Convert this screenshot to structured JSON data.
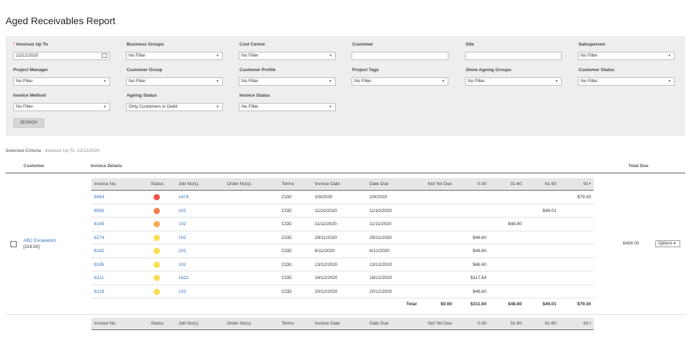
{
  "page": {
    "title": "Aged Receivables Report"
  },
  "filters": {
    "invoices_up_to": {
      "label": "Invoices Up To",
      "required_mark": "*",
      "value": "22/12/2020"
    },
    "business_groups": {
      "label": "Business Groups",
      "value": "No Filter"
    },
    "cost_centre": {
      "label": "Cost Centre",
      "value": "No Filter"
    },
    "customer": {
      "label": "Customer",
      "value": ""
    },
    "site": {
      "label": "Site",
      "value": ""
    },
    "salesperson": {
      "label": "Salesperson",
      "value": "No Filter"
    },
    "project_manager": {
      "label": "Project Manager",
      "value": "No Filter"
    },
    "customer_group": {
      "label": "Customer Group",
      "value": "No Filter"
    },
    "customer_profile": {
      "label": "Customer Profile",
      "value": "No Filter"
    },
    "project_tags": {
      "label": "Project Tags",
      "value": "No Filter"
    },
    "show_ageing_groups": {
      "label": "Show Ageing Groups",
      "value": "No Filter"
    },
    "customer_status": {
      "label": "Customer Status",
      "value": "No Filter"
    },
    "invoice_method": {
      "label": "Invoice Method",
      "value": "No Filter"
    },
    "ageing_status": {
      "label": "Ageing Status",
      "value": "Only Customers in Debit"
    },
    "invoice_status": {
      "label": "Invoice Status",
      "value": "No Filter"
    },
    "search_button": "SEARCH"
  },
  "selected_criteria": {
    "label": "Selected Criteria",
    "text": " - Invoices Up To: 22/12/2020"
  },
  "table": {
    "headers": {
      "customer": "Customer",
      "invoice_details": "Invoice Details",
      "total_due": "Total Due"
    },
    "inner_headers": [
      "Invoice No.",
      "Status",
      "Job No(s).",
      "Order No(s).",
      "Terms",
      "Invoice Date",
      "Date Due",
      "Not Yet Due",
      "0-30",
      "31-60",
      "61-90",
      "91+"
    ],
    "customer": {
      "name": "ABC Excavators",
      "code": "[119.50]",
      "total_due": "$489.05",
      "options_label": "Options ▾"
    },
    "status_colors": {
      "red": "#ef5350",
      "orange": "#f57c4a",
      "amber": "#f9a54f",
      "yellow": "#f7dc4e"
    },
    "rows": [
      {
        "invoice": "8063",
        "status": "red",
        "job": "1474",
        "terms": "COD",
        "invoice_date": "2/9/2020",
        "date_due": "2/9/2020",
        "not_yet_due": "",
        "d0_30": "",
        "d31_60": "",
        "d61_90": "",
        "d91": "$79.30"
      },
      {
        "invoice": "8093",
        "status": "orange",
        "job": "102",
        "terms": "COD",
        "invoice_date": "11/10/2020",
        "date_due": "11/10/2020",
        "not_yet_due": "",
        "d0_30": "",
        "d31_60": "",
        "d61_90": "$49.01",
        "d91": ""
      },
      {
        "invoice": "8149",
        "status": "amber",
        "job": "102",
        "terms": "COD",
        "invoice_date": "11/11/2020",
        "date_due": "11/11/2020",
        "not_yet_due": "",
        "d0_30": "",
        "d31_60": "$48.80",
        "d61_90": "",
        "d91": ""
      },
      {
        "invoice": "8174",
        "status": "yellow",
        "job": "102",
        "terms": "COD",
        "invoice_date": "29/11/2020",
        "date_due": "29/11/2020",
        "not_yet_due": "",
        "d0_30": "$48.60",
        "d31_60": "",
        "d61_90": "",
        "d91": ""
      },
      {
        "invoice": "8182",
        "status": "yellow",
        "job": "102",
        "terms": "COD",
        "invoice_date": "6/12/2020",
        "date_due": "6/12/2020",
        "not_yet_due": "",
        "d0_30": "$48.60",
        "d31_60": "",
        "d61_90": "",
        "d91": ""
      },
      {
        "invoice": "8195",
        "status": "yellow",
        "job": "102",
        "terms": "COD",
        "invoice_date": "13/12/2020",
        "date_due": "13/12/2020",
        "not_yet_due": "",
        "d0_30": "$48.60",
        "d31_60": "",
        "d61_90": "",
        "d91": ""
      },
      {
        "invoice": "8211",
        "status": "yellow",
        "job": "1622",
        "terms": "COD",
        "invoice_date": "16/12/2020",
        "date_due": "16/12/2020",
        "not_yet_due": "",
        "d0_30": "$117.54",
        "d31_60": "",
        "d61_90": "",
        "d91": ""
      },
      {
        "invoice": "8218",
        "status": "yellow",
        "job": "102",
        "terms": "COD",
        "invoice_date": "20/12/2020",
        "date_due": "20/12/2020",
        "not_yet_due": "",
        "d0_30": "$48.60",
        "d31_60": "",
        "d61_90": "",
        "d91": ""
      }
    ],
    "totals": {
      "label": "Total",
      "not_yet_due": "$0.00",
      "d0_30": "$311.94",
      "d31_60": "$48.80",
      "d61_90": "$49.01",
      "d91": "$79.30"
    }
  }
}
